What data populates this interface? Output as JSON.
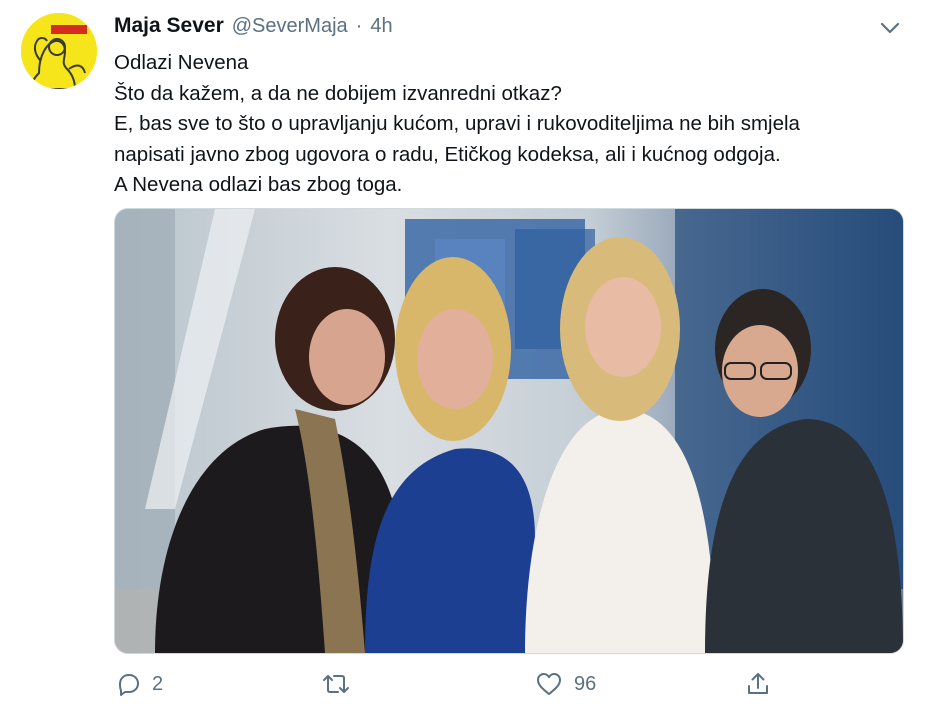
{
  "tweet": {
    "author_name": "Maja Sever",
    "handle": "@SeverMaja",
    "separator": "·",
    "time": "4h",
    "lines": [
      "Odlazi Nevena",
      "Što da kažem, a da ne dobijem izvanredni otkaz?",
      "E, bas sve to što o upravljanju kućom, upravi i rukovoditeljima ne bih smjela",
      "napisati javno zbog ugovora o radu, Etičkog  kodeksa, ali i kućnog odgoja.",
      "A Nevena odlazi bas zbog toga."
    ],
    "avatar": {
      "icon": "riveter-poster-avatar",
      "background": "#f5e51a"
    },
    "media": {
      "description_icon": "group-photo"
    }
  },
  "actions": {
    "reply": {
      "icon": "reply-icon",
      "count": "2"
    },
    "retweet": {
      "icon": "retweet-icon",
      "count": ""
    },
    "like": {
      "icon": "heart-icon",
      "count": "96"
    },
    "share": {
      "icon": "share-icon"
    }
  },
  "colors": {
    "text": "#0f1419",
    "muted": "#5b7083",
    "avatar_bg": "#f5e51a"
  }
}
